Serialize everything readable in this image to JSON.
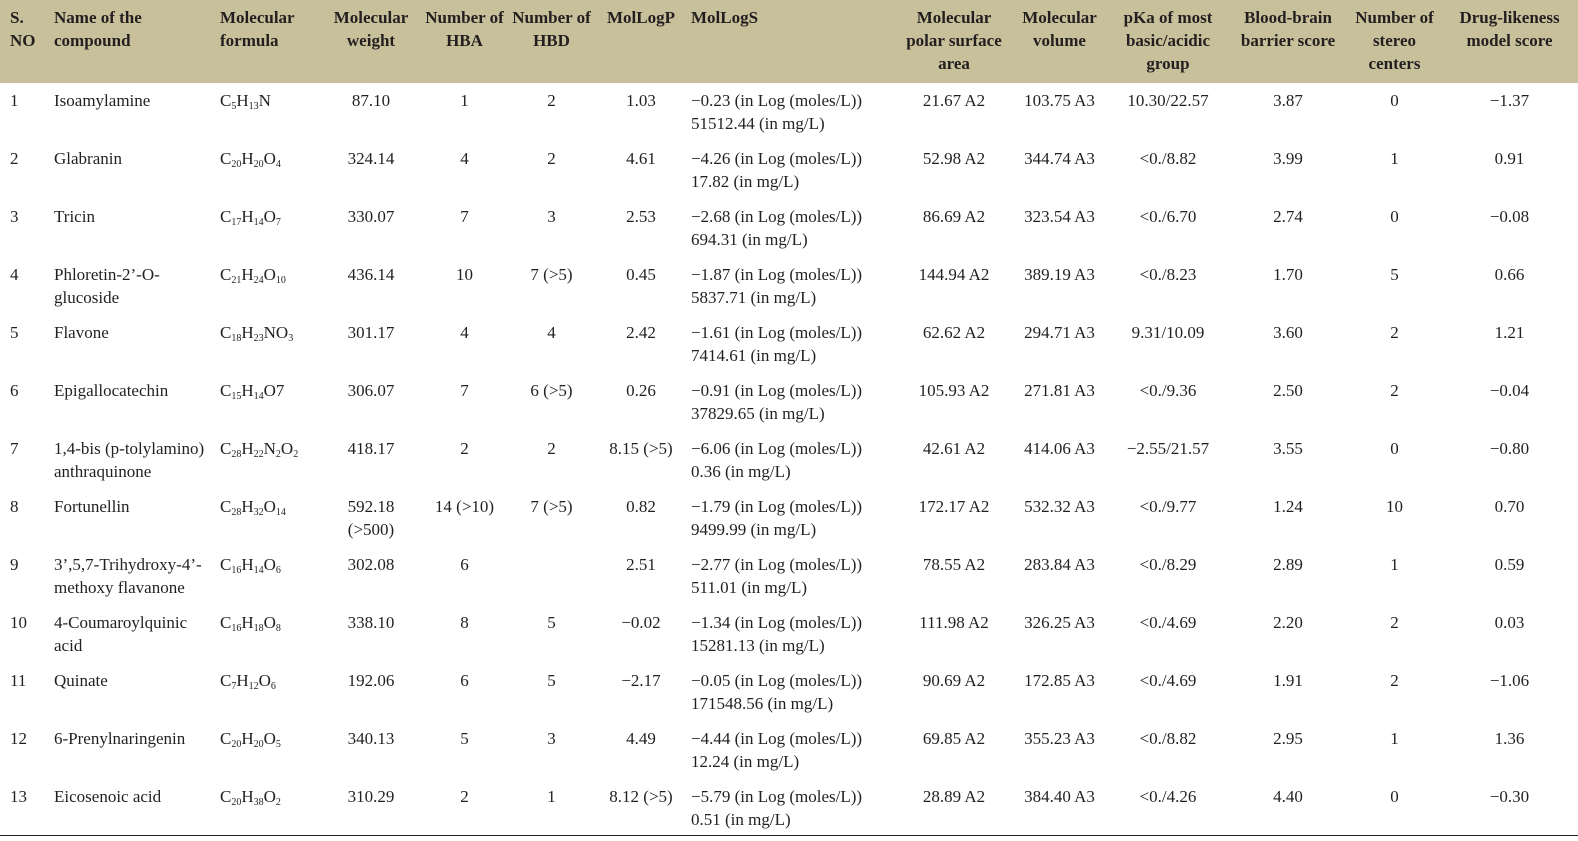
{
  "headers": [
    "S. NO",
    "Name of the compound",
    "Molecular formula",
    "Molecular weight",
    "Number of HBA",
    "Number of HBD",
    "MolLogP",
    "MolLogS",
    "Molecular polar surface area",
    "Molecular volume",
    "pKa of most basic/acidic group",
    "Blood-brain barrier score",
    "Number of stereo centers",
    "Drug-likeness model score"
  ],
  "rows": [
    {
      "no": "1",
      "name": "Isoamylamine",
      "formula": [
        [
          "C",
          "5"
        ],
        [
          "H",
          "13"
        ],
        [
          "N",
          ""
        ]
      ],
      "mw": "87.10",
      "hba": "1",
      "hbd": "2",
      "logp": "1.03",
      "logs1": "−0.23 (in Log (moles/L))",
      "logs2": "51512.44 (in mg/L)",
      "psa": "21.67 A2",
      "vol": "103.75 A3",
      "pka": "10.30/22.57",
      "bbb": "3.87",
      "stereo": "0",
      "drug": "−1.37"
    },
    {
      "no": "2",
      "name": "Glabranin",
      "formula": [
        [
          "C",
          "20"
        ],
        [
          "H",
          "20"
        ],
        [
          "O",
          "4"
        ]
      ],
      "mw": "324.14",
      "hba": "4",
      "hbd": "2",
      "logp": "4.61",
      "logs1": "−4.26 (in Log (moles/L))",
      "logs2": "17.82 (in mg/L)",
      "psa": "52.98 A2",
      "vol": "344.74 A3",
      "pka": "<0./8.82",
      "bbb": "3.99",
      "stereo": "1",
      "drug": "0.91"
    },
    {
      "no": "3",
      "name": "Tricin",
      "formula": [
        [
          "C",
          "17"
        ],
        [
          "H",
          "14"
        ],
        [
          "O",
          "7"
        ]
      ],
      "mw": "330.07",
      "hba": "7",
      "hbd": "3",
      "logp": "2.53",
      "logs1": "−2.68 (in Log (moles/L))",
      "logs2": "694.31 (in mg/L)",
      "psa": "86.69 A2",
      "vol": "323.54 A3",
      "pka": "<0./6.70",
      "bbb": "2.74",
      "stereo": "0",
      "drug": "−0.08"
    },
    {
      "no": "4",
      "name": "Phloretin-2’-O-glucoside",
      "formula": [
        [
          "C",
          "21"
        ],
        [
          "H",
          "24"
        ],
        [
          "O",
          "10"
        ]
      ],
      "mw": "436.14",
      "hba": "10",
      "hbd": "7 (>5)",
      "logp": "0.45",
      "logs1": "−1.87 (in Log (moles/L))",
      "logs2": "5837.71 (in mg/L)",
      "psa": "144.94 A2",
      "vol": "389.19 A3",
      "pka": "<0./8.23",
      "bbb": "1.70",
      "stereo": "5",
      "drug": "0.66"
    },
    {
      "no": "5",
      "name": "Flavone",
      "formula": [
        [
          "C",
          "18"
        ],
        [
          "H",
          "23"
        ],
        [
          "NO",
          "3"
        ]
      ],
      "mw": "301.17",
      "hba": "4",
      "hbd": "4",
      "logp": "2.42",
      "logs1": "−1.61 (in Log (moles/L))",
      "logs2": "7414.61 (in mg/L)",
      "psa": "62.62 A2",
      "vol": "294.71 A3",
      "pka": "9.31/10.09",
      "bbb": "3.60",
      "stereo": "2",
      "drug": "1.21"
    },
    {
      "no": "6",
      "name": "Epigallocatechin",
      "formula": [
        [
          "C",
          "15"
        ],
        [
          "H",
          "14"
        ],
        [
          "O7",
          ""
        ]
      ],
      "mw": "306.07",
      "hba": "7",
      "hbd": "6 (>5)",
      "logp": "0.26",
      "logs1": "−0.91 (in Log (moles/L))",
      "logs2": "37829.65 (in mg/L)",
      "psa": "105.93 A2",
      "vol": "271.81 A3",
      "pka": "<0./9.36",
      "bbb": "2.50",
      "stereo": "2",
      "drug": "−0.04"
    },
    {
      "no": "7",
      "name": "1,4-bis (p-tolylamino) anthraquinone",
      "formula": [
        [
          "C",
          "28"
        ],
        [
          "H",
          "22"
        ],
        [
          "N",
          "2"
        ],
        [
          "O",
          "2"
        ]
      ],
      "mw": "418.17",
      "hba": "2",
      "hbd": "2",
      "logp": "8.15 (>5)",
      "logs1": "−6.06 (in Log (moles/L))",
      "logs2": "0.36 (in mg/L)",
      "psa": "42.61 A2",
      "vol": "414.06 A3",
      "pka": "−2.55/21.57",
      "bbb": "3.55",
      "stereo": "0",
      "drug": "−0.80"
    },
    {
      "no": "8",
      "name": "Fortunellin",
      "formula": [
        [
          "C",
          "28"
        ],
        [
          "H",
          "32"
        ],
        [
          "O",
          "14"
        ]
      ],
      "mw": "592.18 (>500)",
      "hba": "14 (>10)",
      "hbd": "7 (>5)",
      "logp": "0.82",
      "logs1": "−1.79 (in Log (moles/L))",
      "logs2": "9499.99 (in mg/L)",
      "psa": "172.17 A2",
      "vol": "532.32 A3",
      "pka": "<0./9.77",
      "bbb": "1.24",
      "stereo": "10",
      "drug": "0.70"
    },
    {
      "no": "9",
      "name": "3’,5,7-Trihydroxy-4’-methoxy flavanone",
      "formula": [
        [
          "C",
          "16"
        ],
        [
          "H",
          "14"
        ],
        [
          "O",
          "6"
        ]
      ],
      "mw": "302.08",
      "hba": "6",
      "hbd": "",
      "logp": "2.51",
      "logs1": "−2.77 (in Log (moles/L))",
      "logs2": "511.01 (in mg/L)",
      "psa": "78.55 A2",
      "vol": "283.84 A3",
      "pka": "<0./8.29",
      "bbb": "2.89",
      "stereo": "1",
      "drug": "0.59"
    },
    {
      "no": "10",
      "name": "4-Coumaroylquinic acid",
      "formula": [
        [
          "C",
          "16"
        ],
        [
          "H",
          "18"
        ],
        [
          "O",
          "8"
        ]
      ],
      "mw": "338.10",
      "hba": "8",
      "hbd": "5",
      "logp": "−0.02",
      "logs1": "−1.34 (in Log (moles/L))",
      "logs2": "15281.13 (in mg/L)",
      "psa": "111.98 A2",
      "vol": "326.25 A3",
      "pka": "<0./4.69",
      "bbb": "2.20",
      "stereo": "2",
      "drug": "0.03"
    },
    {
      "no": "11",
      "name": "Quinate",
      "formula": [
        [
          "C",
          "7"
        ],
        [
          "H",
          "12"
        ],
        [
          "O",
          "6"
        ]
      ],
      "mw": "192.06",
      "hba": "6",
      "hbd": "5",
      "logp": "−2.17",
      "logs1": "−0.05 (in Log (moles/L))",
      "logs2": "171548.56 (in mg/L)",
      "psa": "90.69 A2",
      "vol": "172.85 A3",
      "pka": "<0./4.69",
      "bbb": "1.91",
      "stereo": "2",
      "drug": "−1.06"
    },
    {
      "no": "12",
      "name": "6-Prenylnaringenin",
      "formula": [
        [
          "C",
          "20"
        ],
        [
          "H",
          "20"
        ],
        [
          "O",
          "5"
        ]
      ],
      "mw": "340.13",
      "hba": "5",
      "hbd": "3",
      "logp": "4.49",
      "logs1": "−4.44 (in Log (moles/L))",
      "logs2": "12.24 (in mg/L)",
      "psa": "69.85 A2",
      "vol": "355.23 A3",
      "pka": "<0./8.82",
      "bbb": "2.95",
      "stereo": "1",
      "drug": "1.36"
    },
    {
      "no": "13",
      "name": "Eicosenoic acid",
      "formula": [
        [
          "C",
          "20"
        ],
        [
          "H",
          "38"
        ],
        [
          "O",
          "2"
        ]
      ],
      "mw": "310.29",
      "hba": "2",
      "hbd": "1",
      "logp": "8.12 (>5)",
      "logs1": "−5.79 (in Log (moles/L))",
      "logs2": "0.51 (in mg/L)",
      "psa": "28.89 A2",
      "vol": "384.40 A3",
      "pka": "<0./4.26",
      "bbb": "4.40",
      "stereo": "0",
      "drug": "−0.30"
    }
  ]
}
